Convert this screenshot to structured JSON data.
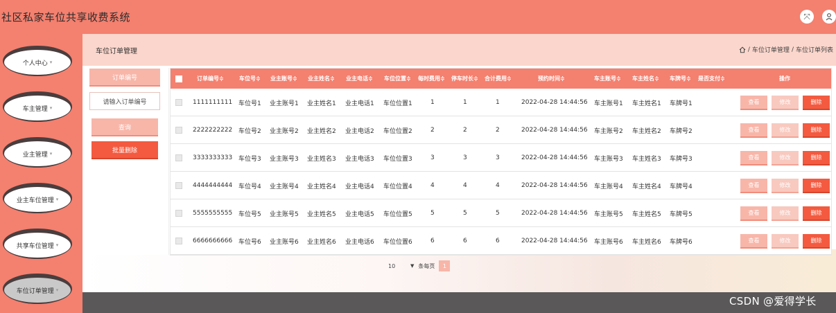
{
  "header": {
    "title": "社区私家车位共享收费系统"
  },
  "sidebar": {
    "items": [
      {
        "label": "个人中心"
      },
      {
        "label": "车主管理"
      },
      {
        "label": "业主管理"
      },
      {
        "label": "业主车位管理"
      },
      {
        "label": "共享车位管理"
      },
      {
        "label": "车位订单管理"
      }
    ]
  },
  "breadcrumb": {
    "title": "车位订单管理",
    "path1": "车位订单管理",
    "path2": "车位订单列表",
    "sep": "/"
  },
  "search": {
    "label": "订单编号",
    "placeholder": "请输入订单编号",
    "query_label": "查询",
    "batch_delete_label": "批量删除"
  },
  "table": {
    "headers": [
      "订单编号",
      "车位号",
      "业主账号",
      "业主姓名",
      "业主电话",
      "车位位置",
      "每时费用",
      "停车时长",
      "合计费用",
      "预约时间",
      "车主账号",
      "车主姓名",
      "车牌号",
      "是否支付",
      "操作"
    ],
    "rows": [
      {
        "order": "1111111111",
        "space": "车位号1",
        "owner_acct": "业主账号1",
        "owner_name": "业主姓名1",
        "owner_phone": "业主电话1",
        "location": "车位位置1",
        "hourly": "1",
        "duration": "1",
        "total": "1",
        "time": "2022-04-28 14:44:56",
        "driver_acct": "车主账号1",
        "driver_name": "车主姓名1",
        "plate": "车牌号1",
        "paid": ""
      },
      {
        "order": "2222222222",
        "space": "车位号2",
        "owner_acct": "业主账号2",
        "owner_name": "业主姓名2",
        "owner_phone": "业主电话2",
        "location": "车位位置2",
        "hourly": "2",
        "duration": "2",
        "total": "2",
        "time": "2022-04-28 14:44:56",
        "driver_acct": "车主账号2",
        "driver_name": "车主姓名2",
        "plate": "车牌号2",
        "paid": ""
      },
      {
        "order": "3333333333",
        "space": "车位号3",
        "owner_acct": "业主账号3",
        "owner_name": "业主姓名3",
        "owner_phone": "业主电话3",
        "location": "车位位置3",
        "hourly": "3",
        "duration": "3",
        "total": "3",
        "time": "2022-04-28 14:44:56",
        "driver_acct": "车主账号3",
        "driver_name": "车主姓名3",
        "plate": "车牌号3",
        "paid": ""
      },
      {
        "order": "4444444444",
        "space": "车位号4",
        "owner_acct": "业主账号4",
        "owner_name": "业主姓名4",
        "owner_phone": "业主电话4",
        "location": "车位位置4",
        "hourly": "4",
        "duration": "4",
        "total": "4",
        "time": "2022-04-28 14:44:56",
        "driver_acct": "车主账号4",
        "driver_name": "车主姓名4",
        "plate": "车牌号4",
        "paid": ""
      },
      {
        "order": "5555555555",
        "space": "车位号5",
        "owner_acct": "业主账号5",
        "owner_name": "业主姓名5",
        "owner_phone": "业主电话5",
        "location": "车位位置5",
        "hourly": "5",
        "duration": "5",
        "total": "5",
        "time": "2022-04-28 14:44:56",
        "driver_acct": "车主账号5",
        "driver_name": "车主姓名5",
        "plate": "车牌号5",
        "paid": ""
      },
      {
        "order": "6666666666",
        "space": "车位号6",
        "owner_acct": "业主账号6",
        "owner_name": "业主姓名6",
        "owner_phone": "业主电话6",
        "location": "车位位置6",
        "hourly": "6",
        "duration": "6",
        "total": "6",
        "time": "2022-04-28 14:44:56",
        "driver_acct": "车主账号6",
        "driver_name": "车主姓名6",
        "plate": "车牌号6",
        "paid": ""
      }
    ],
    "actions": {
      "view": "查看",
      "edit": "修改",
      "delete": "删除"
    }
  },
  "pagination": {
    "page_size": "10",
    "per_page_label": "条每页",
    "current_page": "1"
  },
  "watermark": "CSDN @爱得学长",
  "colors": {
    "primary": "#f4806f",
    "light": "#f8b6a9",
    "danger": "#f35a3f",
    "crumb_bg": "#fbd6cc"
  },
  "icons": {
    "expand": "expand-icon",
    "user": "user-icon",
    "home": "home-icon",
    "sort": "sort-icon",
    "dropdown": "chevron-down-icon"
  }
}
